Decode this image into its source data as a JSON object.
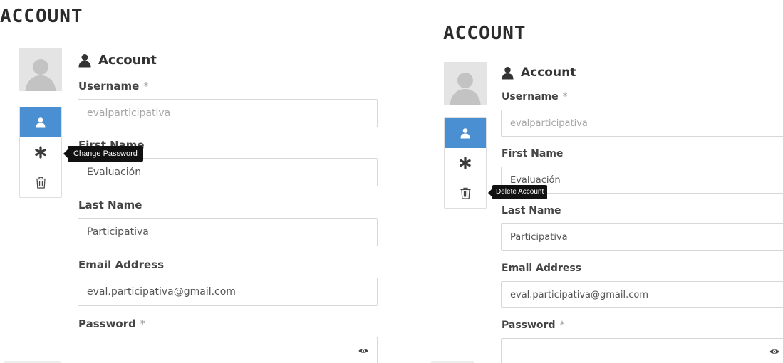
{
  "left": {
    "page_title": "ACCOUNT",
    "section_title": "Account",
    "tooltip": "Change Password",
    "fields": {
      "username": {
        "label": "Username",
        "required": "*",
        "value": "evalparticipativa"
      },
      "first_name": {
        "label": "First Name",
        "value": "Evaluación"
      },
      "last_name": {
        "label": "Last Name",
        "value": "Participativa"
      },
      "email": {
        "label": "Email Address",
        "value": "eval.participativa@gmail.com"
      },
      "password": {
        "label": "Password",
        "required": "*",
        "value": ""
      }
    }
  },
  "right": {
    "page_title": "ACCOUNT",
    "section_title": "Account",
    "tooltip": "Delete Account",
    "fields": {
      "username": {
        "label": "Username",
        "required": "*",
        "value": "evalparticipativa"
      },
      "first_name": {
        "label": "First Name",
        "value": "Evaluación"
      },
      "last_name": {
        "label": "Last Name",
        "value": "Participativa"
      },
      "email": {
        "label": "Email Address",
        "value": "eval.participativa@gmail.com"
      },
      "password": {
        "label": "Password",
        "required": "*",
        "value": ""
      }
    }
  },
  "side_nav_icons": [
    "user-icon",
    "asterisk-icon",
    "trash-icon"
  ],
  "colors": {
    "nav_active": "#4a8fd1",
    "tooltip_bg": "#111111",
    "input_border": "#d7d7d7",
    "title": "#2b2b2b"
  }
}
